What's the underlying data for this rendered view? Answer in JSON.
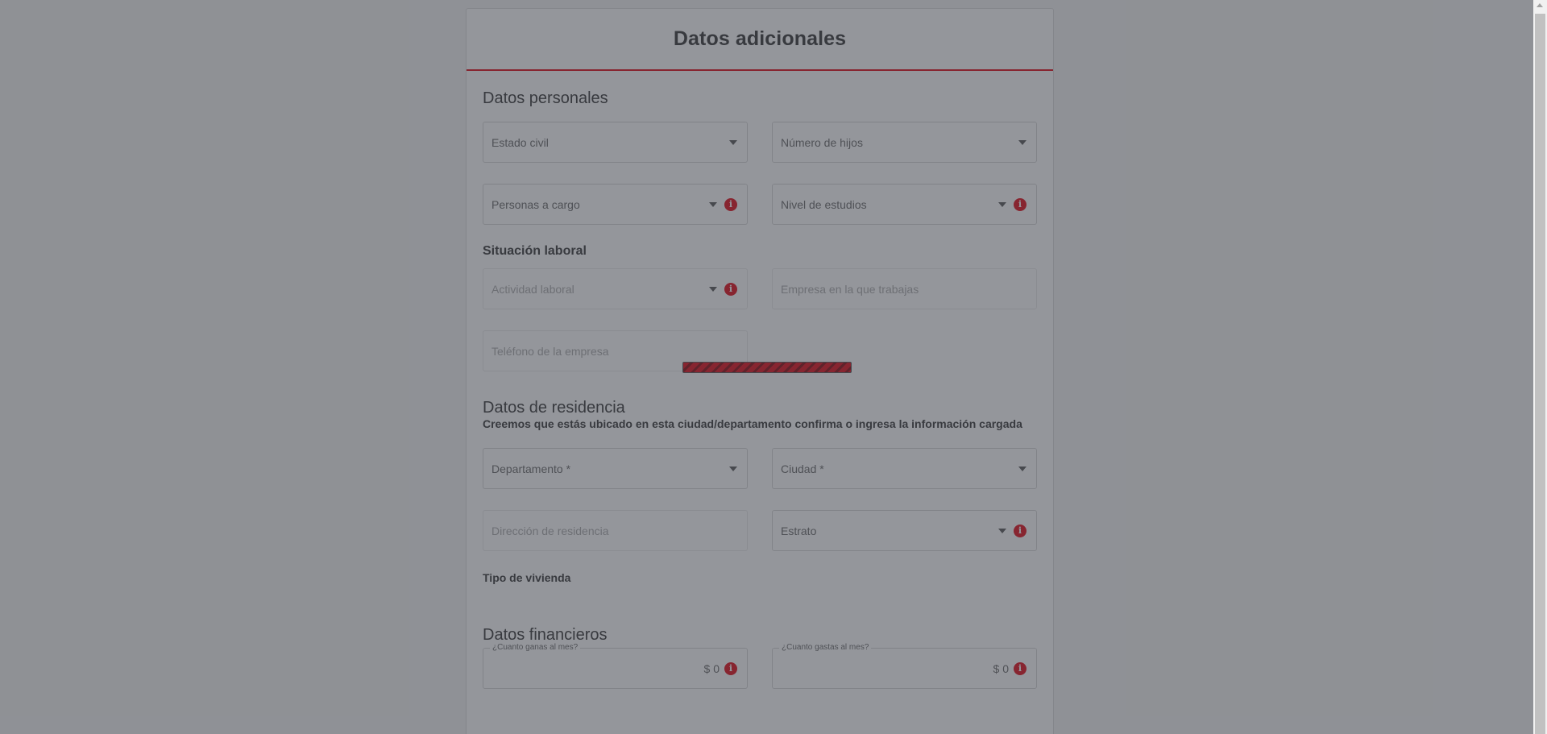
{
  "form": {
    "title": "Datos adicionales",
    "personal": {
      "title": "Datos personales",
      "estado_civil": "Estado civil",
      "numero_hijos": "Número de hijos",
      "personas_cargo": "Personas a cargo",
      "nivel_estudios": "Nivel de estudios"
    },
    "laboral": {
      "title": "Situación laboral",
      "actividad": "Actividad laboral",
      "empresa": "Empresa en la que trabajas",
      "telefono": "Teléfono de la empresa"
    },
    "residencia": {
      "title": "Datos de residencia",
      "hint": "Creemos que estás ubicado en esta ciudad/departamento confirma o ingresa la información cargada",
      "departamento": "Departamento *",
      "ciudad": "Ciudad *",
      "direccion": "Dirección de residencia",
      "estrato": "Estrato",
      "tipo_vivienda": "Tipo de vivienda"
    },
    "financieros": {
      "title": "Datos financieros",
      "ingresos_label": "¿Cuanto ganas al mes?",
      "ingresos_value": "$ 0",
      "gastos_label": "¿Cuanto gastas al mes?",
      "gastos_value": "$ 0"
    },
    "info_glyph": "i"
  },
  "colors": {
    "accent": "#e30613",
    "overlay": "rgba(60, 64, 72, 0.55)"
  },
  "icons": {
    "dropdown": "chevron-down-icon",
    "info": "info-icon"
  }
}
